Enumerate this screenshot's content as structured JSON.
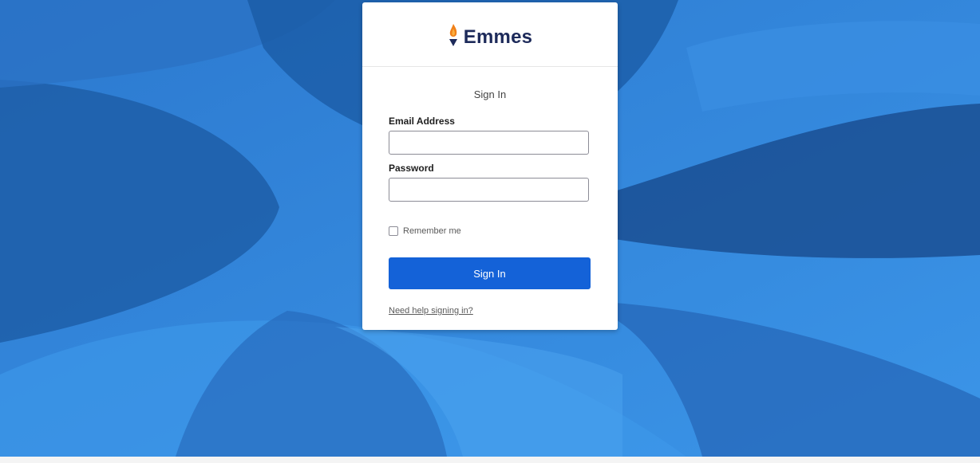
{
  "brand": {
    "name": "Emmes",
    "flame_color": "#f0811a",
    "accent_color": "#1462d8"
  },
  "form": {
    "title": "Sign In",
    "email_label": "Email Address",
    "email_value": "",
    "password_label": "Password",
    "password_value": "",
    "remember_label": "Remember me",
    "remember_checked": false,
    "submit_label": "Sign In",
    "help_link": "Need help signing in?"
  },
  "icons": {
    "logo": "torch-flame-icon",
    "checkbox": "checkbox-unchecked-icon"
  }
}
